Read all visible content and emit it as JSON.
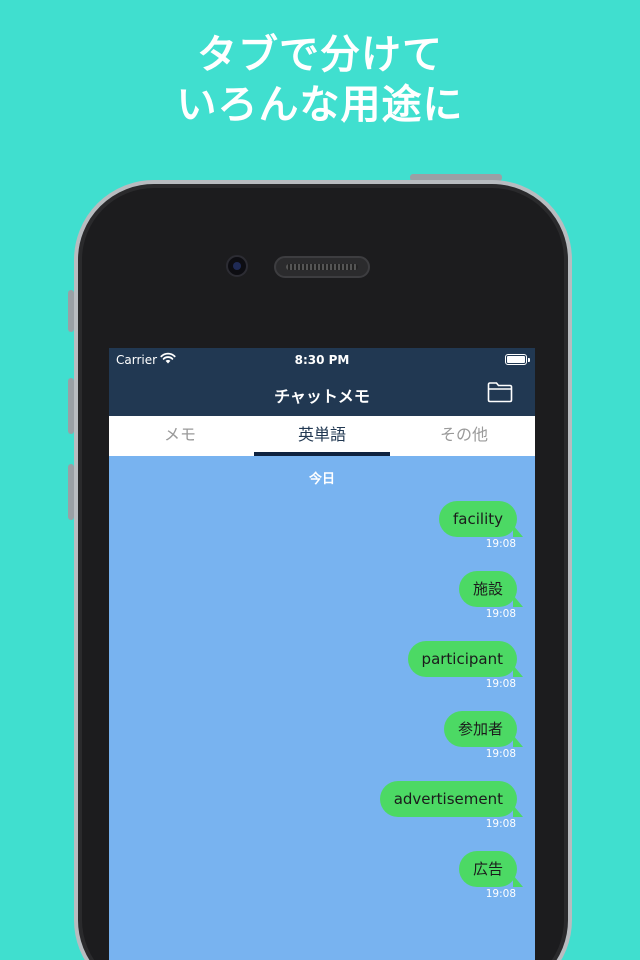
{
  "headline": {
    "line1": "タブで分けて",
    "line2": "いろんな用途に"
  },
  "status_bar": {
    "carrier": "Carrier",
    "time": "8:30 PM"
  },
  "nav": {
    "title": "チャットメモ",
    "folder_icon": "folder-icon"
  },
  "tabs": [
    {
      "label": "メモ",
      "active": false
    },
    {
      "label": "英単語",
      "active": true
    },
    {
      "label": "その他",
      "active": false
    }
  ],
  "chat": {
    "date_label": "今日",
    "messages": [
      {
        "text": "facility",
        "time": "19:08"
      },
      {
        "text": "施設",
        "time": "19:08"
      },
      {
        "text": "participant",
        "time": "19:08"
      },
      {
        "text": "参加者",
        "time": "19:08"
      },
      {
        "text": "advertisement",
        "time": "19:08"
      },
      {
        "text": "広告",
        "time": "19:08"
      }
    ]
  },
  "colors": {
    "background": "#40dfcf",
    "nav_bar": "#213852",
    "chat_background": "#78b3f0",
    "bubble": "#4cd964",
    "active_tab_indicator": "#0f2340"
  }
}
